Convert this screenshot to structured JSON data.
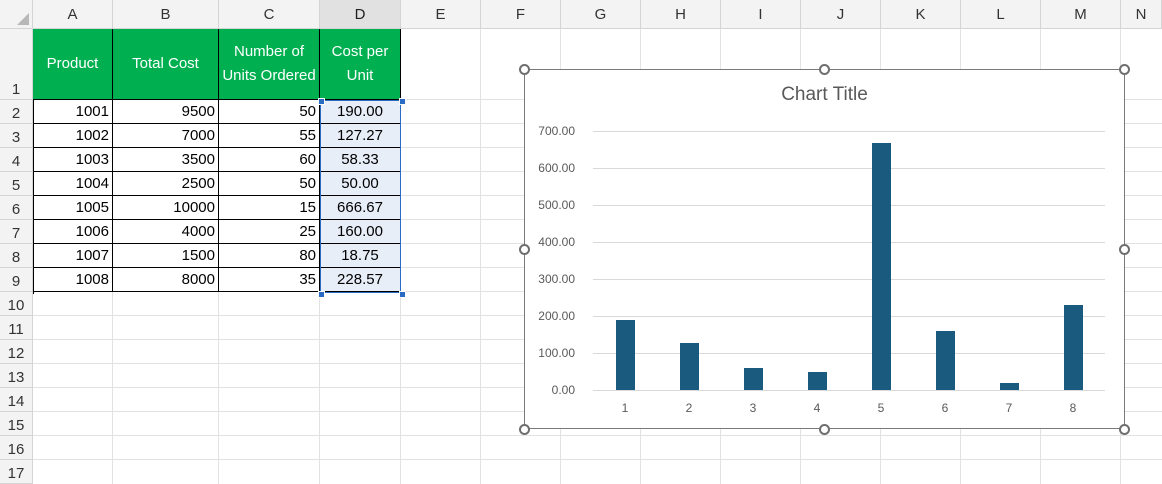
{
  "columns": [
    "A",
    "B",
    "C",
    "D",
    "E",
    "F",
    "G",
    "H",
    "I",
    "J",
    "K",
    "L",
    "M",
    "N"
  ],
  "rows": [
    "1",
    "2",
    "3",
    "4",
    "5",
    "6",
    "7",
    "8",
    "9",
    "10",
    "11",
    "12",
    "13",
    "14",
    "15",
    "16",
    "17"
  ],
  "table": {
    "headers": [
      "Product",
      "Total Cost",
      "Number of Units Ordered",
      "Cost per Unit"
    ],
    "rows": [
      [
        "1001",
        "9500",
        "50",
        "190.00"
      ],
      [
        "1002",
        "7000",
        "55",
        "127.27"
      ],
      [
        "1003",
        "3500",
        "60",
        "58.33"
      ],
      [
        "1004",
        "2500",
        "50",
        "50.00"
      ],
      [
        "1005",
        "10000",
        "15",
        "666.67"
      ],
      [
        "1006",
        "4000",
        "25",
        "160.00"
      ],
      [
        "1007",
        "1500",
        "80",
        "18.75"
      ],
      [
        "1008",
        "8000",
        "35",
        "228.57"
      ]
    ]
  },
  "chart_data": {
    "type": "bar",
    "title": "Chart Title",
    "categories": [
      "1",
      "2",
      "3",
      "4",
      "5",
      "6",
      "7",
      "8"
    ],
    "values": [
      190.0,
      127.27,
      58.33,
      50.0,
      666.67,
      160.0,
      18.75,
      228.57
    ],
    "ylim": [
      0,
      700
    ],
    "yticks": [
      "0.00",
      "100.00",
      "200.00",
      "300.00",
      "400.00",
      "500.00",
      "600.00",
      "700.00"
    ],
    "grid": true,
    "bar_color": "#195a7e"
  },
  "colors": {
    "header_fill": "#00b050",
    "selection": "#2a6cc4"
  }
}
